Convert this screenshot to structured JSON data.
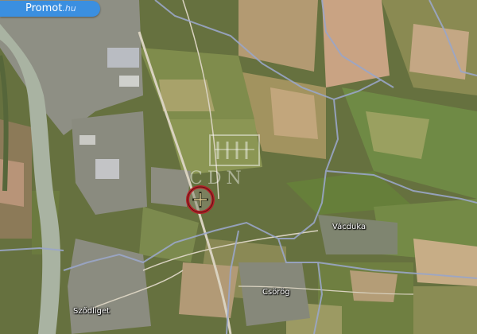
{
  "brand": {
    "name": "Promot",
    "suffix": ".hu"
  },
  "watermark": {
    "text": "CDN"
  },
  "places": [
    {
      "key": "vacduka",
      "label": "Vácduka"
    },
    {
      "key": "csorog",
      "label": "Csörög"
    },
    {
      "key": "szodliget",
      "label": "Sződliget"
    }
  ],
  "marker": {
    "icon": "crosshair-target-icon"
  },
  "colors": {
    "river": "#a9b3a2",
    "boundary": "#9aa6c8",
    "road": "#d9d2c0",
    "marker_ring": "#b3232a",
    "badge": "#3b8fe0"
  }
}
